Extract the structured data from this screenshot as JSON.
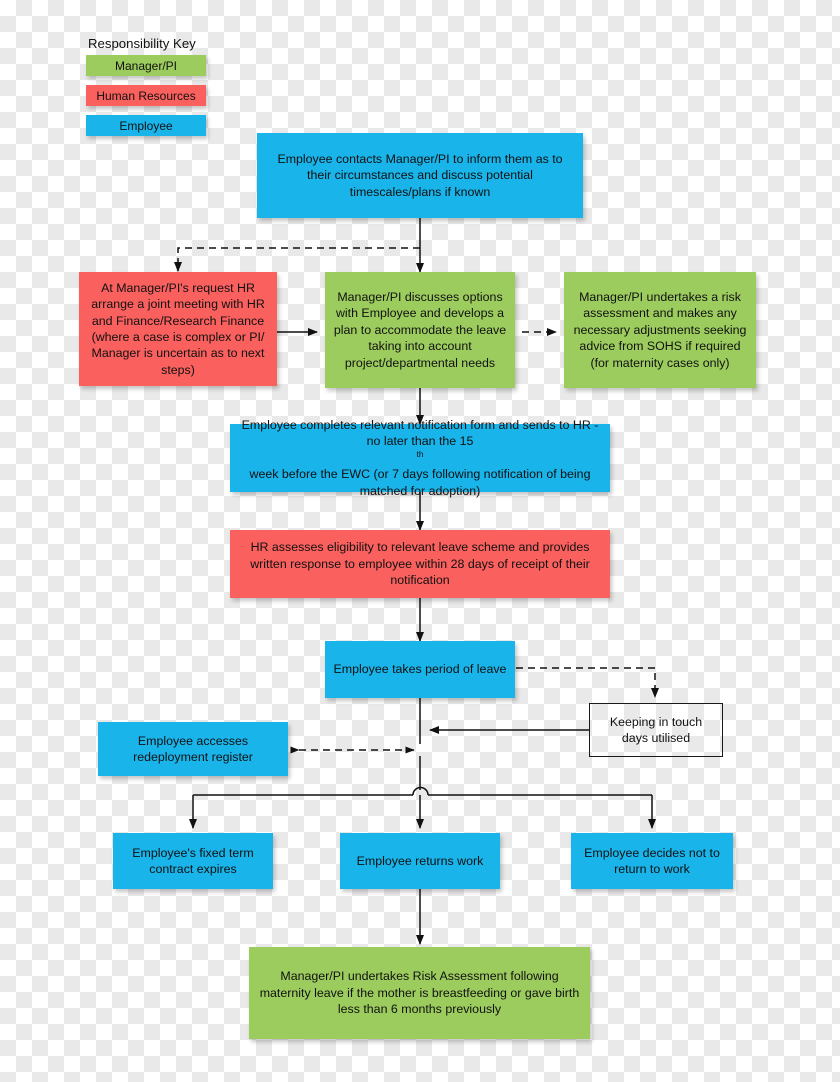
{
  "legend": {
    "title": "Responsibility Key",
    "items": [
      {
        "label": "Manager/PI",
        "color": "#9ccc5e",
        "key": "manager"
      },
      {
        "label": "Human Resources",
        "color": "#f9605e",
        "key": "hr"
      },
      {
        "label": "Employee",
        "color": "#18b4ea",
        "key": "employee"
      }
    ]
  },
  "colors": {
    "manager_green": "#9ccc5e",
    "hr_red": "#f9605e",
    "employee_blue": "#18b4ea",
    "connector": "#111111",
    "plain_border": "#1a1a1a"
  },
  "nodes": {
    "employee_contacts": {
      "text": "Employee contacts Manager/PI to inform them as to their circumstances and discuss potential timescales/plans if known",
      "role": "Employee"
    },
    "hr_joint_meeting": {
      "text": "At Manager/PI's request HR arrange a joint meeting with HR and Finance/Research Finance (where a case is complex or PI/ Manager is uncertain as to next steps)",
      "role": "Human Resources"
    },
    "manager_discusses": {
      "text": "Manager/PI discusses options with Employee and develops a plan to accommodate the leave taking into account project/departmental needs",
      "role": "Manager/PI"
    },
    "manager_risk_assessment": {
      "text": "Manager/PI undertakes a risk assessment and makes any necessary adjustments seeking advice from SOHS if required (for maternity cases only)",
      "role": "Manager/PI"
    },
    "employee_notification_form": {
      "text_before": "Employee completes relevant notification form and sends to HR - no later than the 15",
      "ordinal_suffix": "th",
      "text_after": " week before the EWC (or 7 days following notification of being matched for adoption)",
      "role": "Employee"
    },
    "hr_assesses": {
      "text": "HR assesses eligibility to relevant leave scheme and provides written response to employee within 28 days of receipt of their notification",
      "role": "Human Resources"
    },
    "employee_takes_leave": {
      "text": "Employee takes period of leave",
      "role": "Employee"
    },
    "keeping_in_touch": {
      "text": "Keeping in touch days utilised",
      "role": "Neutral"
    },
    "redeployment_register": {
      "text": "Employee accesses redeployment register",
      "role": "Employee"
    },
    "fixed_term_expires": {
      "text": "Employee's fixed term contract expires",
      "role": "Employee"
    },
    "employee_returns": {
      "text": "Employee returns work",
      "role": "Employee"
    },
    "employee_not_return": {
      "text": "Employee decides not to return to work",
      "role": "Employee"
    },
    "final_risk_assessment": {
      "text": "Manager/PI undertakes Risk Assessment following maternity leave if the mother is breastfeeding or gave birth less than 6 months previously",
      "role": "Manager/PI"
    }
  },
  "connectors": [
    {
      "name": "contacts-to-discusses",
      "style": "solid",
      "arrows": "end"
    },
    {
      "name": "contacts-to-hr-meeting",
      "style": "dashed",
      "arrows": "end"
    },
    {
      "name": "hr-meeting-to-discusses",
      "style": "solid",
      "arrows": "end"
    },
    {
      "name": "discusses-to-risk-assessment",
      "style": "dashed",
      "arrows": "end"
    },
    {
      "name": "discusses-to-notification",
      "style": "solid",
      "arrows": "end"
    },
    {
      "name": "notification-to-hr-assesses",
      "style": "solid",
      "arrows": "end"
    },
    {
      "name": "hr-assesses-to-takes-leave",
      "style": "solid",
      "arrows": "end"
    },
    {
      "name": "takes-leave-to-keeping",
      "style": "dashed",
      "arrows": "end"
    },
    {
      "name": "keeping-to-spine",
      "style": "solid",
      "arrows": "end"
    },
    {
      "name": "redeployment-to-spine",
      "style": "dashed",
      "arrows": "both"
    },
    {
      "name": "spine-to-fixed-term",
      "style": "solid",
      "arrows": "end"
    },
    {
      "name": "spine-to-returns",
      "style": "solid",
      "arrows": "end"
    },
    {
      "name": "spine-to-not-return",
      "style": "solid",
      "arrows": "end"
    },
    {
      "name": "returns-to-final-risk",
      "style": "solid",
      "arrows": "end"
    }
  ]
}
